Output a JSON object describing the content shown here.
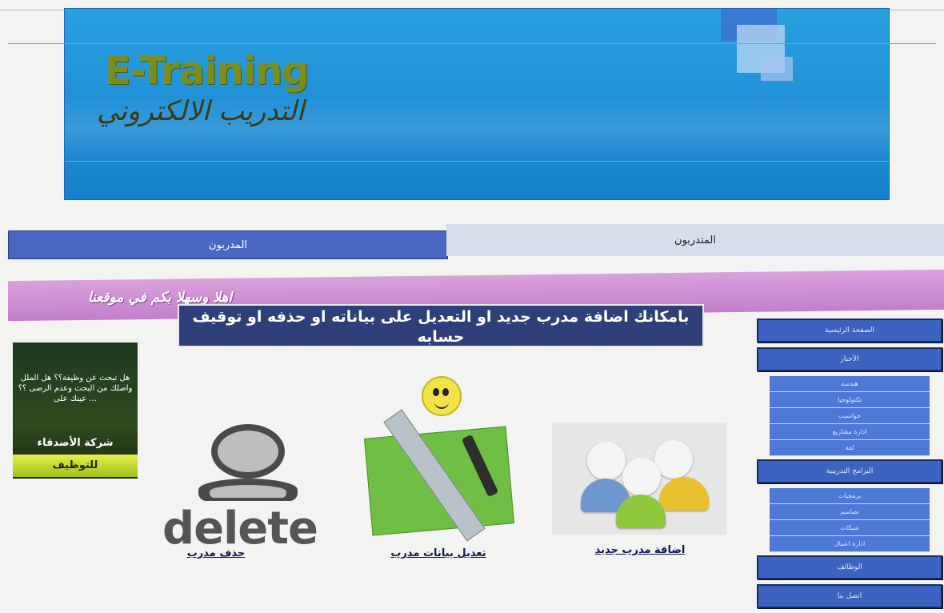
{
  "header": {
    "logo_en": "E-Training",
    "logo_ar": "التدريب الالكتروني"
  },
  "nav": {
    "left": "المدربون",
    "right": "المتدربون"
  },
  "welcome": "اهلا وسهلا بكم في موقعنا",
  "notice": {
    "line1": "بامكانك اضافة مدرب جديد او التعديل على بياناته او حذفه او توقيف حسابه"
  },
  "ad": {
    "text": "هل تبحث عن وظيفة؟؟ هل الملل واصلك من البحث وعدم الرضى ؟؟ عينك على ...",
    "company": "شركة الأصدقاء",
    "hire": "للتوظيف"
  },
  "actions": {
    "delete_word": "delete",
    "delete_label": "حذف مدرب",
    "edit_label": "تعديل بيانات مدرب",
    "add_label": "اضافة مدرب جديد"
  },
  "sidebar": {
    "home": "الصفحة الرئيسية",
    "news": "الأخبار",
    "news_items": [
      "هندسه",
      "تكنولوجيا",
      "حواسيب",
      "ادارة مشاريع",
      "لغة"
    ],
    "programs": "البرامج التدريبية",
    "program_items": [
      "برمجيات",
      "تصاميم",
      "شبكات",
      "ادارة اعمال"
    ],
    "jobs": "الوظائف",
    "contact": "اتصل بنا"
  },
  "colors": {
    "banner": "#1f8fd6",
    "nav_active": "#4a67c2",
    "welcome": "#c27fcb",
    "sidebar": "#3d63c0"
  }
}
